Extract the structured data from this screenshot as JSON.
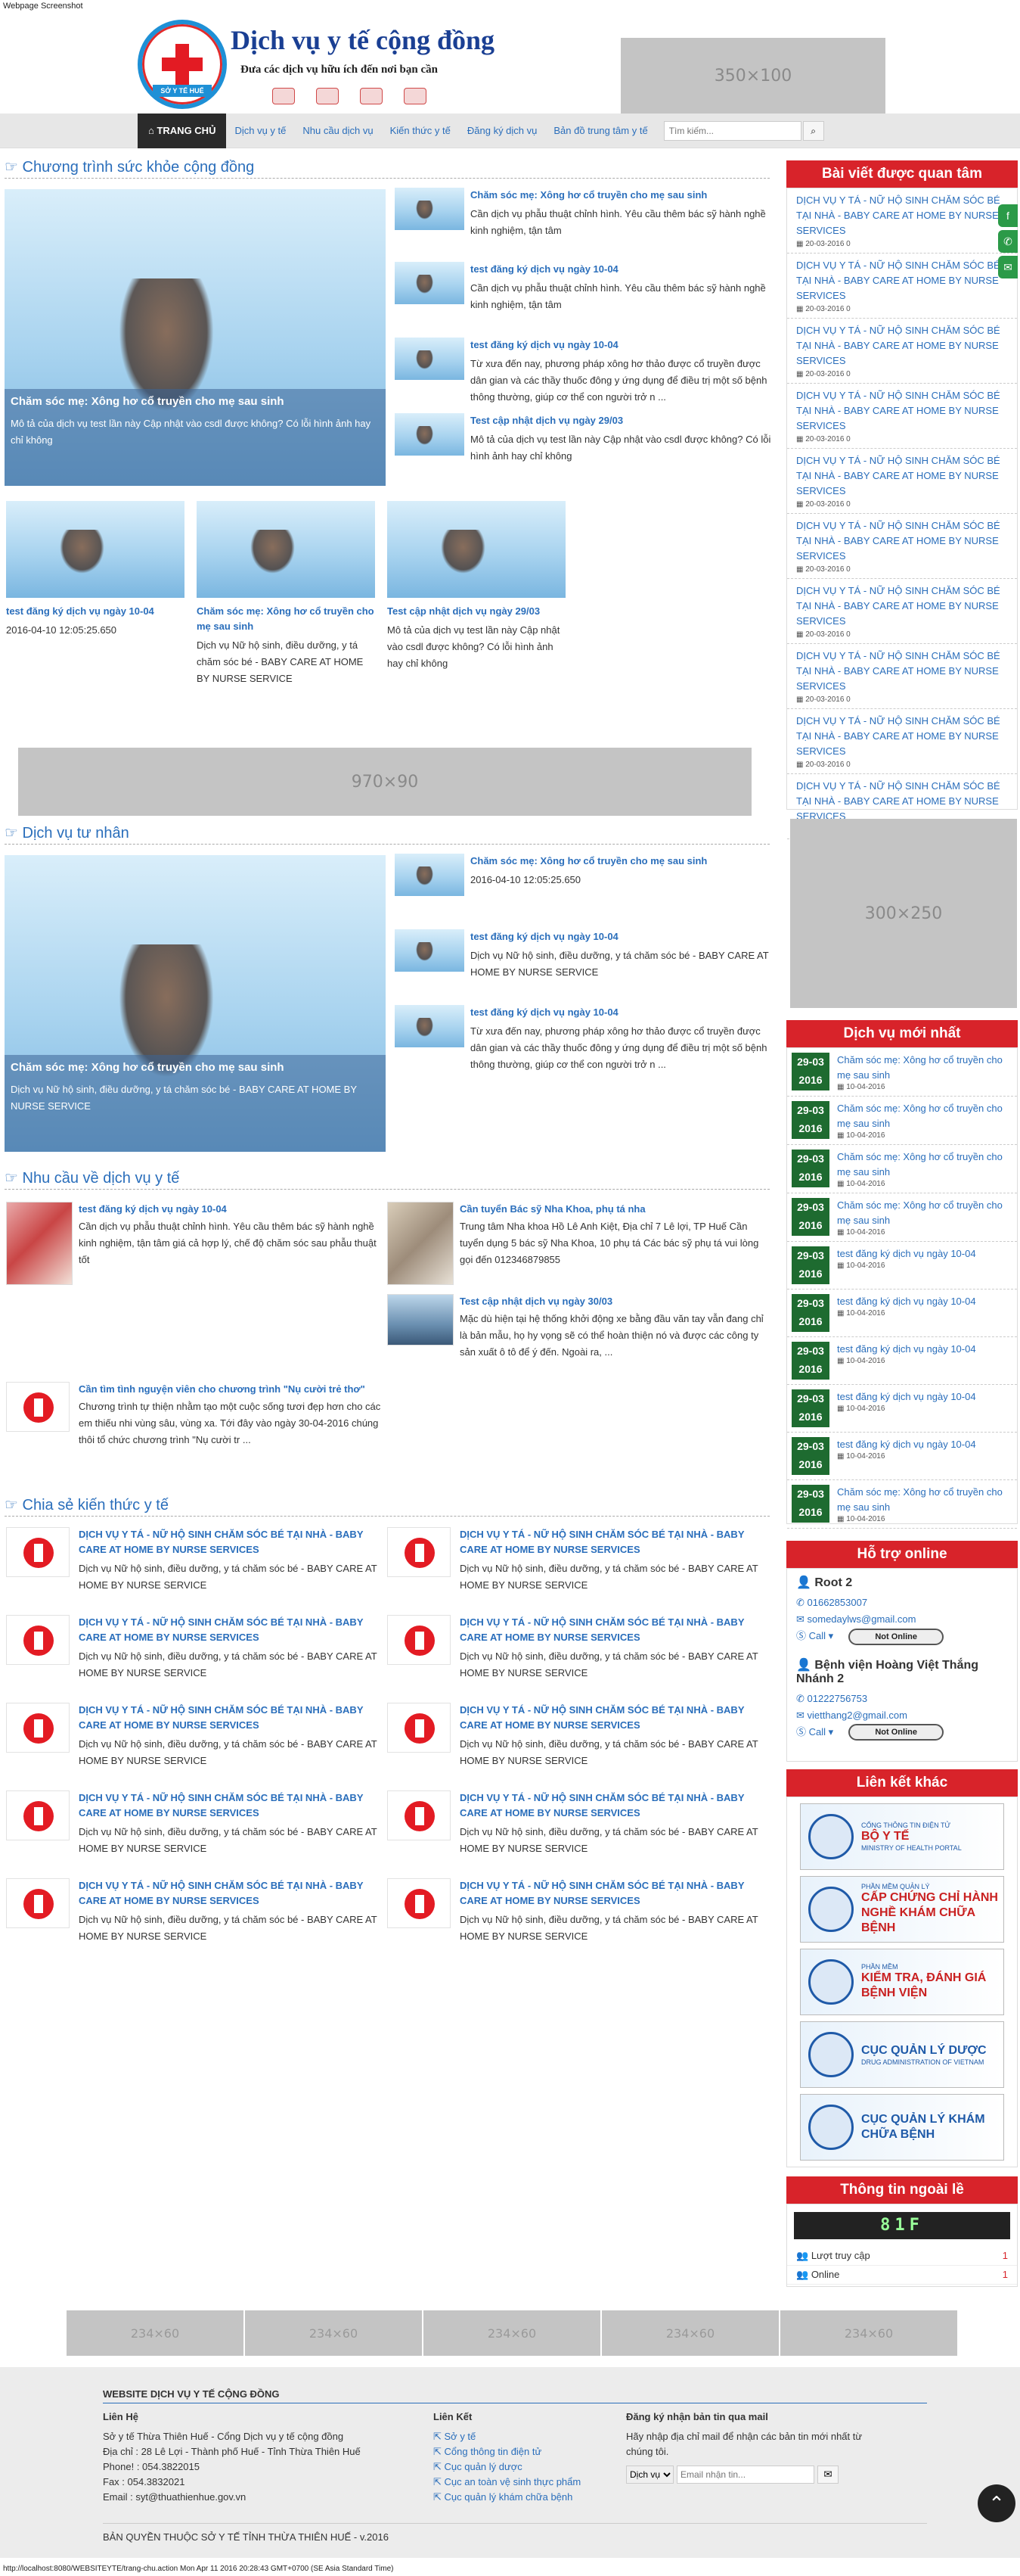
{
  "caption": "Webpage Screenshot",
  "header": {
    "logo_text": "SỞ Y TẾ HUẾ",
    "title": "Dịch vụ y tế cộng đồng",
    "subtitle": "Đưa các dịch vụ hữu ích đến nơi bạn cần",
    "ad_top": "350×100"
  },
  "nav": {
    "home": "TRANG CHỦ",
    "items": [
      "Dịch vụ y tế",
      "Nhu cầu dịch vụ",
      "Kiến thức y tế",
      "Đăng ký dịch vụ",
      "Bản đồ trung tâm y tế"
    ],
    "search_placeholder": "Tìm kiếm..."
  },
  "section1": {
    "title": "Chương trình sức khỏe cộng đồng",
    "feature": {
      "title": "Chăm sóc mẹ: Xông hơ cổ truyền cho mẹ sau sinh",
      "desc": "Mô tả của dịch vụ test lần này  Cập nhật vào csdl được không? Có lỗi hình ảnh hay chỉ không"
    },
    "side": [
      {
        "title": "Chăm sóc mẹ: Xông hơ cổ truyền cho mẹ sau sinh",
        "desc": "Cần dịch vụ phẫu thuật chỉnh hình. Yêu cầu thêm bác sỹ hành nghề kinh nghiệm, tận tâm"
      },
      {
        "title": "test đăng ký dịch vụ ngày 10-04",
        "desc": "Cần dịch vụ phẫu thuật chỉnh hình. Yêu cầu thêm bác sỹ hành nghề kinh nghiệm, tận tâm"
      },
      {
        "title": "test đăng ký dịch vụ ngày 10-04",
        "desc": "Từ xưa đến nay, phương pháp xông hơ thảo được cổ truyền được dân gian và các thầy thuốc đông y ứng dụng để điều trị một số bệnh thông thường, giúp cơ thể con người trở n ..."
      },
      {
        "title": "Test cập nhật dịch vụ ngày 29/03",
        "desc": "Mô tả của dịch vụ test lần này  Cập nhật vào csdl được không? Có lỗi hình ảnh hay chỉ không"
      }
    ],
    "cards": [
      {
        "title": "test đăng ký dịch vụ ngày 10-04",
        "desc": "2016-04-10 12:05:25.650"
      },
      {
        "title": "Chăm sóc mẹ: Xông hơ cổ truyền cho mẹ sau sinh",
        "desc": "Dịch vụ Nữ hộ sinh, điều dưỡng, y tá chăm sóc bé - BABY CARE AT HOME BY NURSE SERVICE"
      },
      {
        "title": "Test cập nhật dịch vụ ngày 29/03",
        "desc": "Mô tả của dịch vụ test lần này  Cập nhật vào csdl được không? Có lỗi hình ảnh hay chỉ không"
      }
    ]
  },
  "ad_mid": "970×90",
  "section2": {
    "title": "Dịch vụ tư nhân",
    "feature": {
      "title": "Chăm sóc mẹ: Xông hơ cổ truyền cho mẹ sau sinh",
      "desc": "Dịch vụ Nữ hộ sinh, điều dưỡng, y tá chăm sóc bé - BABY CARE AT HOME BY NURSE SERVICE"
    },
    "side": [
      {
        "title": "Chăm sóc mẹ: Xông hơ cổ truyền cho mẹ sau sinh",
        "desc": "2016-04-10 12:05:25.650"
      },
      {
        "title": "test đăng ký dịch vụ ngày 10-04",
        "desc": "Dịch vụ Nữ hộ sinh, điều dưỡng, y tá chăm sóc bé - BABY CARE AT HOME BY NURSE SERVICE"
      },
      {
        "title": "test đăng ký dịch vụ ngày 10-04",
        "desc": "Từ xưa đến nay, phương pháp xông hơ thảo được cổ truyền được dân gian và các thầy thuốc đông y ứng dụng để điều trị một số bệnh thông thường, giúp cơ thể con người trở n ..."
      }
    ]
  },
  "section3": {
    "title": "Nhu cầu về dịch vụ y tế",
    "items": [
      {
        "title": "test đăng ký dịch vụ ngày 10-04",
        "desc": "Cần dịch vụ phẫu thuật chỉnh hình. Yêu cầu thêm bác sỹ hành nghề kinh nghiệm, tận tâm giá cả hợp lý, chế độ chăm sóc sau phẫu thuật tốt"
      },
      {
        "title": "Cần tuyển Bác sỹ Nha Khoa, phụ tá nha",
        "desc": "Trung tâm Nha khoa Hồ Lê Anh Kiệt, Địa chỉ 7 Lê lợi, TP Huế Cần tuyển dụng 5 bác sỹ Nha Khoa, 10 phụ tá Các bác sỹ phụ tá vui lòng gọi đến 012346879855"
      },
      {
        "title": "Test cập nhật dịch vụ ngày 30/03",
        "desc": "Mặc dù hiện tại hệ thống khởi động xe bằng đầu văn tay vẫn đang chỉ là bản mẫu, họ hy vọng sẽ có thể hoàn thiện nó và được các công ty sản xuất ô tô để ý đến. Ngoài ra, ..."
      },
      {
        "title": "Cần tìm tình nguyện viên cho chương trình \"Nụ cười trẻ thơ\"",
        "desc": "Chương trình tự thiện nhằm tạo một cuộc sống tươi đẹp hơn cho các em thiếu nhi vùng sâu, vùng xa. Tới đây vào ngày 30-04-2016 chúng thôi tổ chức chương trình \"Nụ cười tr ..."
      }
    ]
  },
  "section4": {
    "title": "Chia sẻ kiến thức y tế",
    "item_title": "DỊCH VỤ Y TÁ - NỮ HỘ SINH CHĂM SÓC BÉ TẠI NHÀ - BABY CARE AT HOME BY NURSE SERVICES",
    "item_desc": "Dịch vụ Nữ hộ sinh, điều dưỡng, y tá chăm sóc bé - BABY CARE AT HOME BY NURSE SERVICE"
  },
  "right": {
    "popular_title": "Bài viết được quan tâm",
    "popular_item": "DỊCH VỤ Y TÁ - NỮ HỘ SINH CHĂM SÓC BÉ TẠI NHÀ - BABY CARE AT HOME BY NURSE SERVICES",
    "popular_meta": "20-03-2016  0",
    "ad_side": "300×250",
    "new_title": "Dịch vụ mới nhất",
    "new_items": [
      {
        "d": "29-03",
        "y": "2016",
        "t": "Chăm sóc mẹ: Xông hơ cổ truyền cho mẹ sau sinh",
        "m": "10-04-2016"
      },
      {
        "d": "29-03",
        "y": "2016",
        "t": "Chăm sóc mẹ: Xông hơ cổ truyền cho mẹ sau sinh",
        "m": "10-04-2016"
      },
      {
        "d": "29-03",
        "y": "2016",
        "t": "Chăm sóc mẹ: Xông hơ cổ truyền cho mẹ sau sinh",
        "m": "10-04-2016"
      },
      {
        "d": "29-03",
        "y": "2016",
        "t": "Chăm sóc mẹ: Xông hơ cổ truyền cho mẹ sau sinh",
        "m": "10-04-2016"
      },
      {
        "d": "29-03",
        "y": "2016",
        "t": "test đăng ký dịch vụ ngày 10-04",
        "m": "10-04-2016"
      },
      {
        "d": "29-03",
        "y": "2016",
        "t": "test đăng ký dịch vụ ngày 10-04",
        "m": "10-04-2016"
      },
      {
        "d": "29-03",
        "y": "2016",
        "t": "test đăng ký dịch vụ ngày 10-04",
        "m": "10-04-2016"
      },
      {
        "d": "29-03",
        "y": "2016",
        "t": "test đăng ký dịch vụ ngày 10-04",
        "m": "10-04-2016"
      },
      {
        "d": "29-03",
        "y": "2016",
        "t": "test đăng ký dịch vụ ngày 10-04",
        "m": "10-04-2016"
      },
      {
        "d": "29-03",
        "y": "2016",
        "t": "Chăm sóc mẹ: Xông hơ cổ truyền cho mẹ sau sinh",
        "m": "10-04-2016"
      }
    ],
    "support_title": "Hỗ trợ online",
    "support": [
      {
        "name": "Root 2",
        "phone": "01662853007",
        "email": "somedaylws@gmail.com",
        "call": "Call",
        "status": "Not Online"
      },
      {
        "name": "Bệnh viện Hoàng Việt Thắng Nhánh 2",
        "phone": "01222756753",
        "email": "vietthang2@gmail.com",
        "call": "Call",
        "status": "Not Online"
      }
    ],
    "links_title": "Liên kết khác",
    "links": [
      {
        "top": "CỔNG THÔNG TIN ĐIỆN TỬ",
        "main": "BỘ Y TẾ",
        "bottom": "MINISTRY OF HEALTH PORTAL"
      },
      {
        "top": "PHẦN MỀM QUẢN LÝ",
        "main": "CẤP CHỨNG CHỈ HÀNH NGHỀ KHÁM CHỮA BỆNH",
        "bottom": ""
      },
      {
        "top": "PHẦN MỀM",
        "main": "KIỂM TRA, ĐÁNH GIÁ BỆNH VIỆN",
        "bottom": ""
      },
      {
        "top": "",
        "main": "CỤC QUẢN LÝ DƯỢC",
        "bottom": "DRUG ADMINISTRATION OF VIETNAM"
      },
      {
        "top": "",
        "main": "CỤC QUẢN LÝ KHÁM CHỮA BỆNH",
        "bottom": ""
      }
    ],
    "stats_title": "Thông tin ngoài lề",
    "counter": "81F",
    "stats": [
      {
        "label": "Lượt truy cập",
        "value": "1"
      },
      {
        "label": "Online",
        "value": "1"
      }
    ]
  },
  "bottom_ads": [
    "234×60",
    "234×60",
    "234×60",
    "234×60",
    "234×60"
  ],
  "footer": {
    "title": "WEBSITE DỊCH VỤ Y TẾ CỘNG ĐỒNG",
    "contact_heading": "Liên Hệ",
    "contact": [
      "Sở y tế Thừa Thiên Huế - Cổng Dịch vụ y tế cộng đồng",
      "Địa chỉ : 28 Lê Lợi - Thành phố Huế - Tỉnh Thừa Thiên Huế",
      "Phone! : 054.3822015",
      "Fax : 054.3832021",
      "Email : syt@thuathienhue.gov.vn"
    ],
    "links_heading": "Liên Kết",
    "links": [
      "Sở y tế",
      "Cổng thông tin điện tử",
      "Cục quản lý dược",
      "Cục an toàn vệ sinh thực phẩm",
      "Cục quản lý khám chữa bệnh"
    ],
    "subscribe_heading": "Đăng ký nhận bản tin qua mail",
    "subscribe_desc": "Hãy nhập địa chỉ mail để nhận các bản tin mới nhất từ chúng tôi.",
    "subscribe_select": "Dịch vụ",
    "subscribe_placeholder": "Email nhận tin...",
    "copyright": "BẢN QUYỀN THUỘC SỞ Y TẾ TỈNH THỪA THIÊN HUẾ - v.2016"
  },
  "footer_url": "http://localhost:8080/WEBSITEYTE/trang-chu.action Mon Apr 11 2016 20:28:43 GMT+0700 (SE Asia Standard Time)"
}
